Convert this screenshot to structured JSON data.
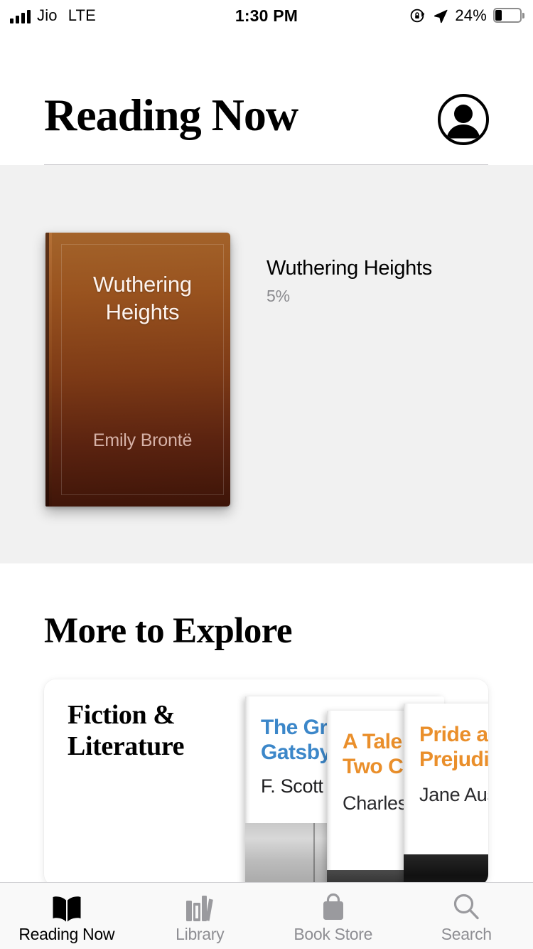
{
  "status_bar": {
    "carrier": "Jio",
    "network": "LTE",
    "time": "1:30 PM",
    "battery_percent": "24%",
    "icons": [
      "signal-bars-icon",
      "rotation-lock-icon",
      "location-arrow-icon",
      "battery-icon"
    ]
  },
  "header": {
    "title": "Reading Now",
    "avatar_icon": "person-avatar-icon"
  },
  "reading_now": {
    "book": {
      "cover_title": "Wuthering\nHeights",
      "cover_title_line1": "Wuthering",
      "cover_title_line2": "Heights",
      "cover_author": "Emily Brontë",
      "meta_title": "Wuthering Heights",
      "progress": "5%",
      "more_icon": "ellipsis-icon",
      "cover_colors": {
        "top": "#a4642b",
        "bottom": "#3d1408",
        "title_text": "#fdf3ee",
        "author_text": "#d6b2a8"
      }
    },
    "section_background": "#f1f1f1"
  },
  "explore": {
    "heading": "More to Explore",
    "card": {
      "category": "Fiction & Literature",
      "books": [
        {
          "title_line1": "The Great",
          "title_line2": "Gatsby",
          "author": "F. Scott",
          "accent": "#3c87c9"
        },
        {
          "title_line1": "A Tale of",
          "title_line2": "Two Cities",
          "author": "Charles",
          "accent": "#ea8f2b"
        },
        {
          "title_line1": "Pride and",
          "title_line2": "Prejudice",
          "author": "Jane Austen",
          "accent": "#ea8f2b"
        }
      ]
    }
  },
  "tab_bar": {
    "active_index": 0,
    "active_color": "#000000",
    "inactive_color": "#8e8e93",
    "items": [
      {
        "label": "Reading Now",
        "icon": "open-book-icon"
      },
      {
        "label": "Library",
        "icon": "bookshelf-icon"
      },
      {
        "label": "Book Store",
        "icon": "shopping-bag-icon"
      },
      {
        "label": "Search",
        "icon": "magnifier-icon"
      }
    ]
  }
}
